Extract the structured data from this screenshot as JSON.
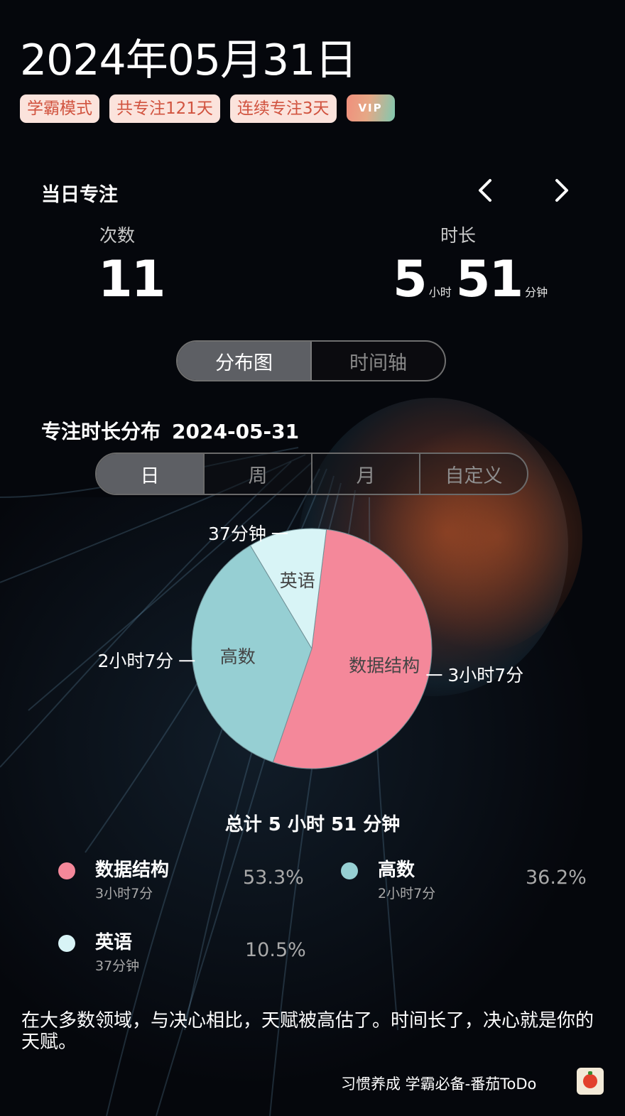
{
  "header": {
    "date": "2024年05月31日",
    "tags": [
      "学霸模式",
      "共专注121天",
      "连续专注3天"
    ],
    "vip": "VIP"
  },
  "daily": {
    "title": "当日专注",
    "count_label": "次数",
    "count_value": "11",
    "duration_label": "时长",
    "duration_hours": "5",
    "hours_unit": "小时",
    "duration_minutes": "51",
    "minutes_unit": "分钟"
  },
  "view_tabs": [
    "分布图",
    "时间轴"
  ],
  "distribution": {
    "title": "专注时长分布",
    "date": "2024-05-31",
    "range_tabs": [
      "日",
      "周",
      "月",
      "自定义"
    ],
    "total": "总计 5 小时 51 分钟"
  },
  "chart_data": {
    "type": "pie",
    "slices": [
      {
        "name": "数据结构",
        "minutes": 187,
        "duration_text": "3小时7分",
        "percent": 53.3,
        "percent_text": "53.3%",
        "color": "#f4889a"
      },
      {
        "name": "高数",
        "minutes": 127,
        "duration_text": "2小时7分",
        "percent": 36.2,
        "percent_text": "36.2%",
        "color": "#96cfd3"
      },
      {
        "name": "英语",
        "minutes": 37,
        "duration_text": "37分钟",
        "percent": 10.5,
        "percent_text": "10.5%",
        "color": "#d8f4f6"
      }
    ],
    "legend": [
      {
        "name": "数据结构",
        "sub": "3小时7分",
        "pct": "53.3%"
      },
      {
        "name": "高数",
        "sub": "2小时7分",
        "pct": "36.2%"
      },
      {
        "name": "英语",
        "sub": "37分钟",
        "pct": "10.5%"
      }
    ]
  },
  "quote": "在大多数领域，与决心相比，天赋被高估了。时间长了，决心就是你的天赋。",
  "footer": "习惯养成 学霸必备-番茄ToDo",
  "icons": [
    "chevron-left-icon",
    "chevron-right-icon",
    "tomato-icon"
  ]
}
